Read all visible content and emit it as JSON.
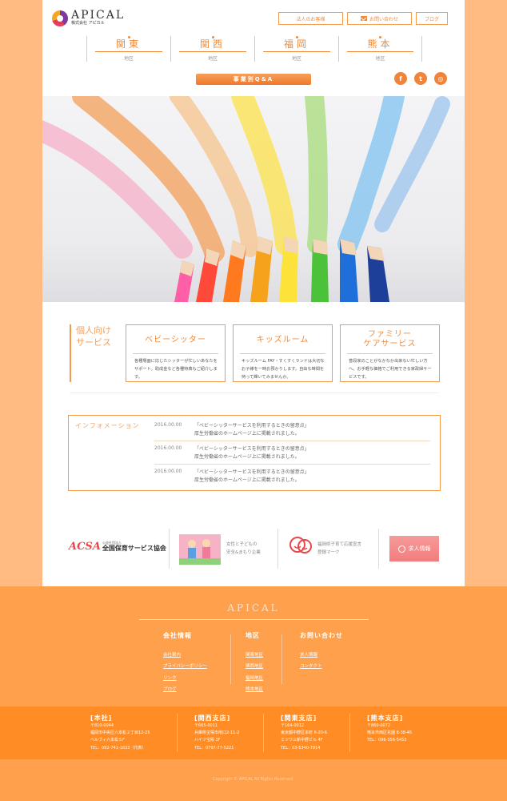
{
  "header": {
    "logo_main": "APICAL",
    "logo_sub": "株式会社 アピカル",
    "top_links": [
      "法人のお客様",
      "お問い合わせ",
      "ブログ"
    ],
    "regions": [
      {
        "name": "関東",
        "sub": "地区"
      },
      {
        "name": "関西",
        "sub": "地区"
      },
      {
        "name": "福岡",
        "sub": "地区"
      },
      {
        "name": "熊本",
        "sub": "地区"
      }
    ],
    "qa_label": "事業別Q&A",
    "social": [
      "f",
      "t",
      "◎"
    ]
  },
  "services": {
    "title": "個人向け\nサービス",
    "cards": [
      {
        "name": "ベビーシッター",
        "desc": "各種場面に応じたシッターが忙しいあなたをサポート。助成金など各種特典もご紹介します。"
      },
      {
        "name": "キッズルーム",
        "desc": "キッズルーム FAY・すくすくランドは大切なお子様を一時お預かりします。自由な時間を持って輝いてみませんか。"
      },
      {
        "name": "ファミリー\nケアサービス",
        "desc": "普段家のことがなかなか出来ない忙しい方へ。お手軽な価格でご利用できる家政婦サービスです。"
      }
    ]
  },
  "info": {
    "title": "インフォメーション",
    "items": [
      {
        "date": "2016.00.00",
        "text": "「ベビーシッターサービスを利用するときの留意点」\n厚生労働省のホームページ上に掲載されました。"
      },
      {
        "date": "2016.00.00",
        "text": "「ベビーシッターサービスを利用するときの留意点」\n厚生労働省のホームページ上に掲載されました。"
      },
      {
        "date": "2016.00.00",
        "text": "「ベビーシッターサービスを利用するときの留意点」\n厚生労働省のホームページ上に掲載されました。"
      }
    ]
  },
  "banners": {
    "acsa_mark": "ACSA",
    "acsa_small": "公益社団法人",
    "acsa_name": "全国保育サービス協会",
    "kids_text": "女性と子どもの\n安全&まもり企業",
    "fukuoka_text": "福岡県子育て応援宣言\n登録マーク",
    "recruit_label": "求人情報"
  },
  "footer": {
    "logo": "APICAL",
    "columns": [
      {
        "head": "会社情報",
        "links": [
          "会社案内",
          "プライバシーポリシー",
          "リンク",
          "ブログ"
        ]
      },
      {
        "head": "地区",
        "links": [
          "関東地区",
          "関西地区",
          "福岡地区",
          "熊本地区"
        ]
      },
      {
        "head": "お問い合わせ",
        "links": [
          "求人情報",
          "コンタクト"
        ]
      }
    ],
    "branches": [
      {
        "name": "[本社]",
        "lines": [
          "〒810-0044",
          "福岡市中央区六本松２丁目12-25",
          "ベルヴィ六本松５F",
          "TEL：092-741-1833（代表）"
        ]
      },
      {
        "name": "[関西支店]",
        "lines": [
          "〒665-0011",
          "兵庫県宝塚市南口2-11-2",
          "ハイツ宝殿 3F",
          "TEL：0797-77-5221"
        ]
      },
      {
        "name": "[関東支店]",
        "lines": [
          "〒164-0012",
          "東京都中野区本町 6-20-6",
          "ミツワ三新中野ビル 4F",
          "TEL：03-5340-7914"
        ]
      },
      {
        "name": "[熊本支店]",
        "lines": [
          "〒860-0072",
          "熊本市西区花園 6-38-45",
          "TEL：096-356-5453"
        ]
      }
    ],
    "copyright": "Copyright © APICAL All Rights Reserved."
  },
  "colors": {
    "accent": "#f08a3a",
    "background": "#ffbb82",
    "footer": "#ffa04d",
    "branch_bar": "#ff8c24"
  }
}
